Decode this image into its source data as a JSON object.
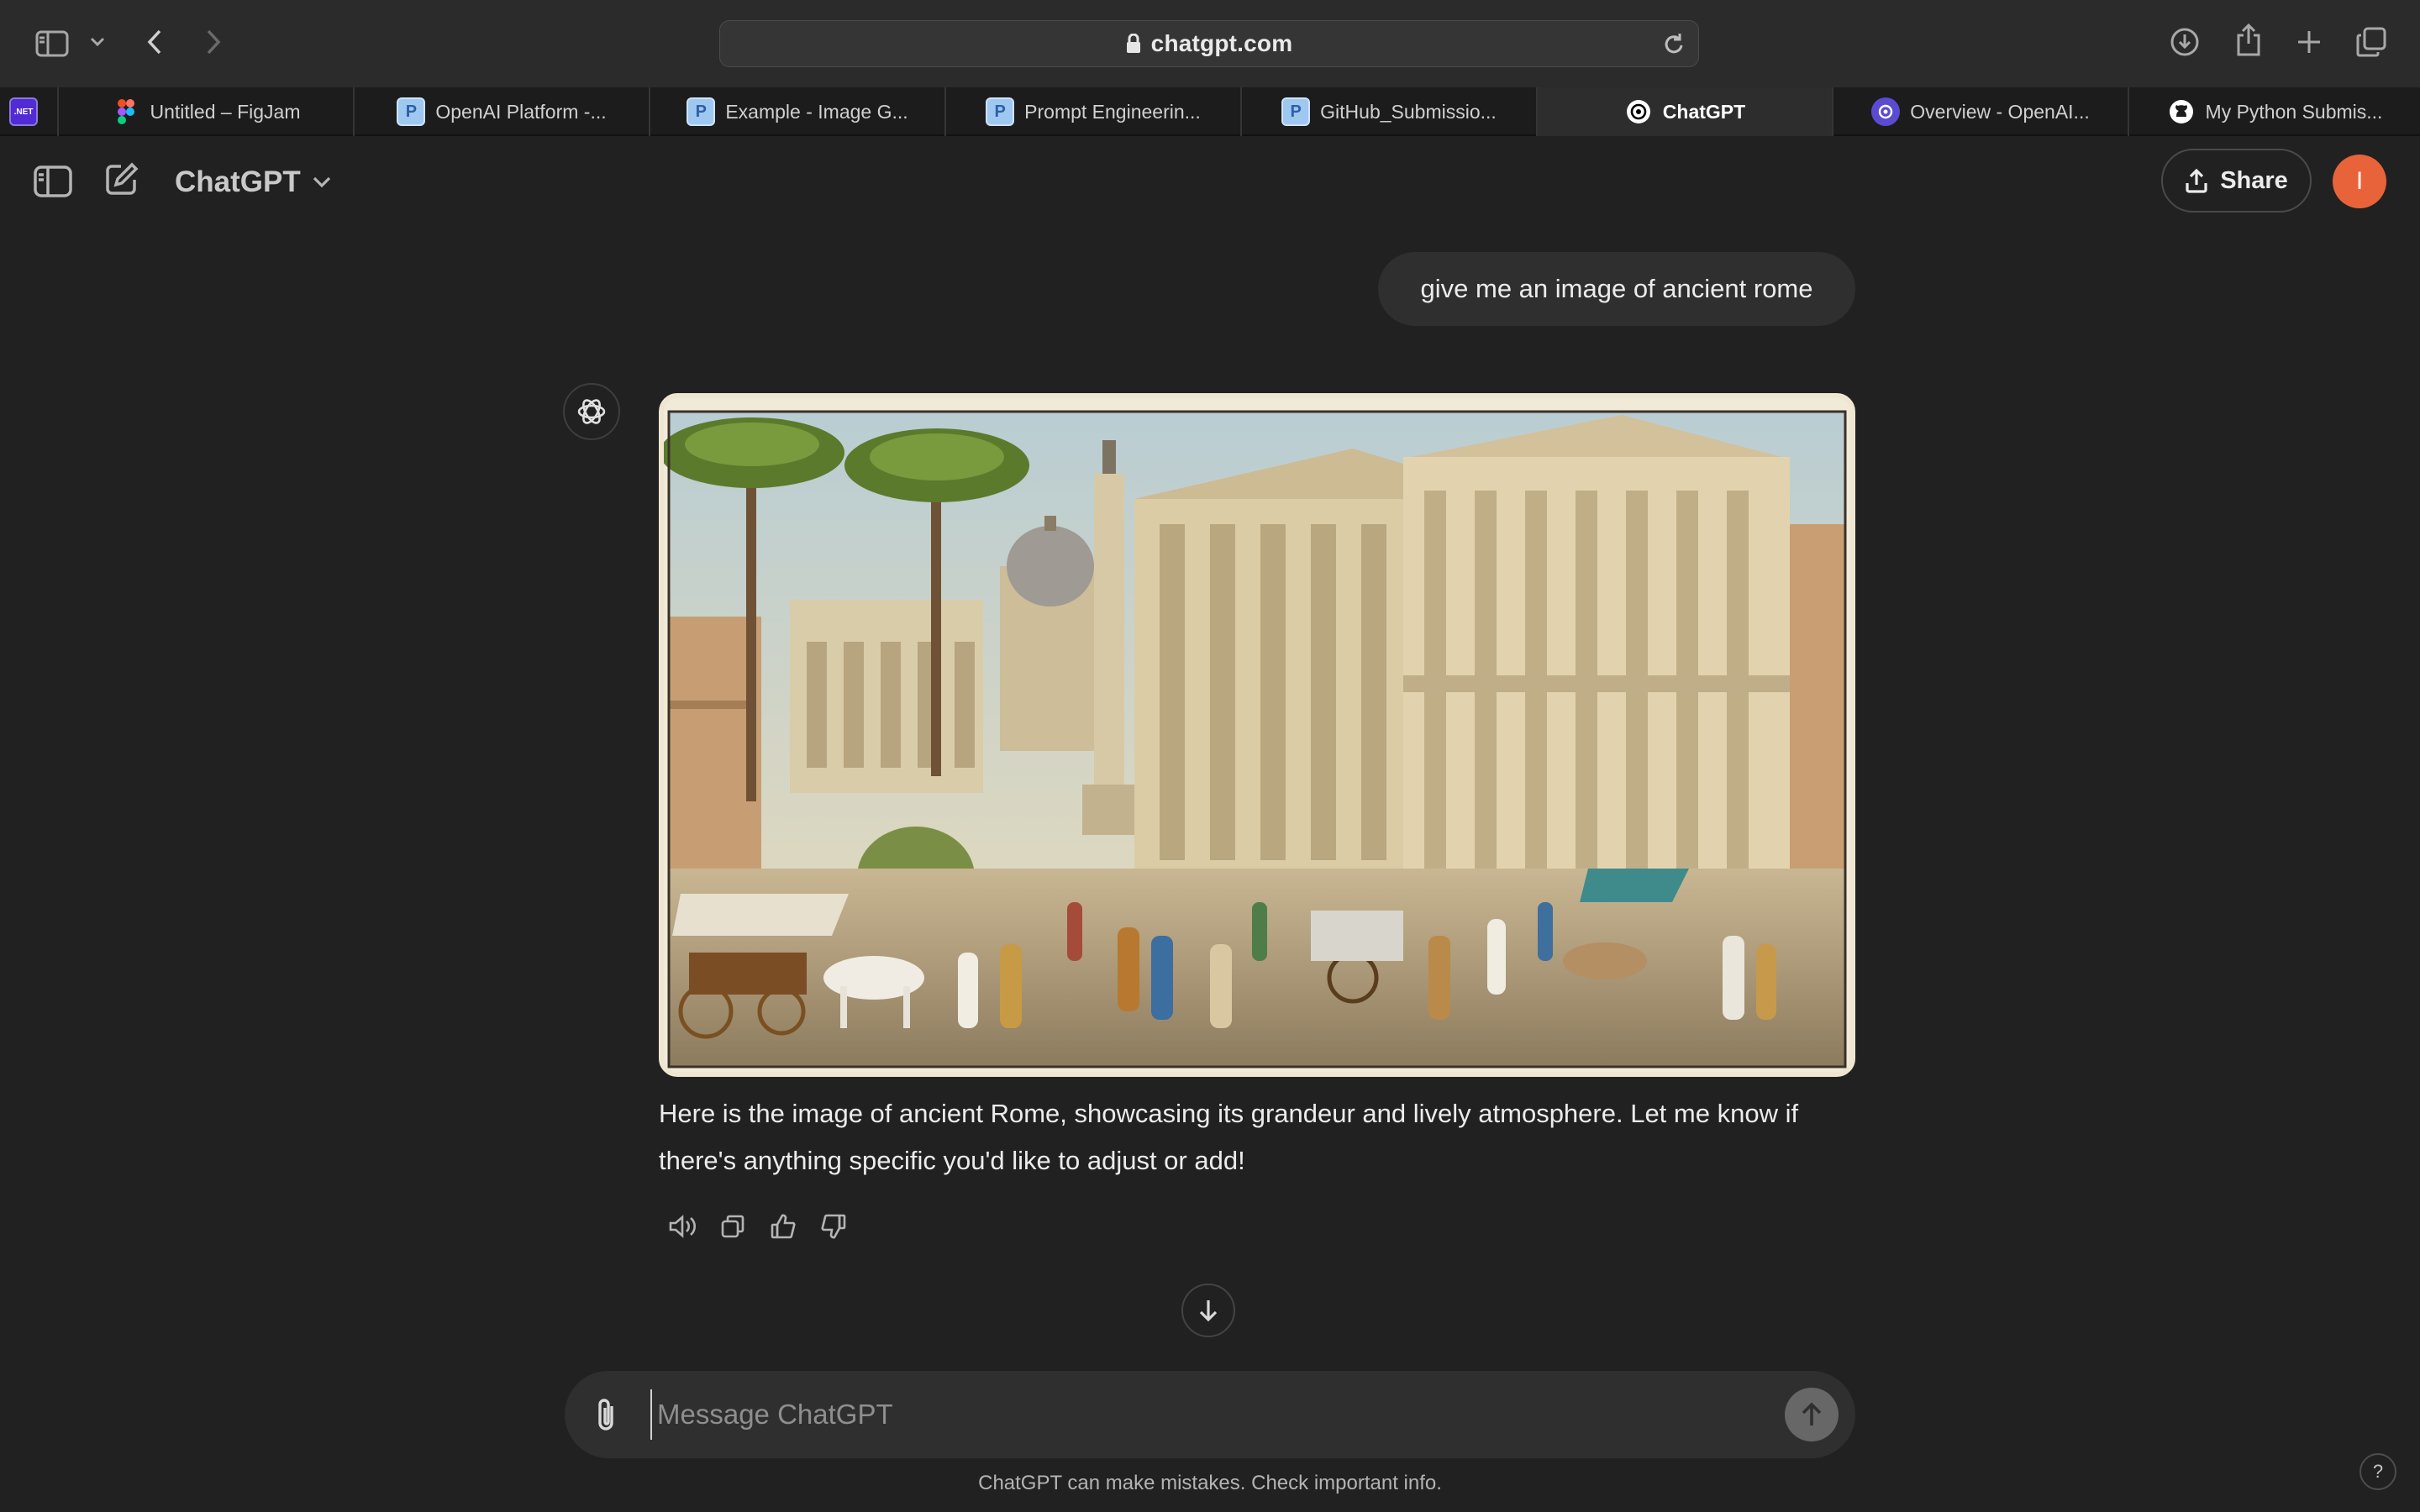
{
  "browser": {
    "url": "chatgpt.com",
    "tabs": [
      {
        "label": "",
        "favicon": ".NET"
      },
      {
        "label": "Untitled – FigJam",
        "favicon": "figma-icon"
      },
      {
        "label": "OpenAI Platform -...",
        "favicon": "P"
      },
      {
        "label": "Example - Image G...",
        "favicon": "P"
      },
      {
        "label": "Prompt Engineerin...",
        "favicon": "P"
      },
      {
        "label": "GitHub_Submissio...",
        "favicon": "P"
      },
      {
        "label": "ChatGPT",
        "favicon": "openai-icon",
        "active": true
      },
      {
        "label": "Overview - OpenAI...",
        "favicon": "openai-icon"
      },
      {
        "label": "My Python Submis...",
        "favicon": "github-icon"
      }
    ]
  },
  "header": {
    "model": "ChatGPT",
    "share_label": "Share",
    "avatar_initial": "I",
    "avatar_color": "#e8633a"
  },
  "conversation": {
    "user_message": "give me an image of ancient rome",
    "assistant_reply": "Here is the image of ancient Rome, showcasing its grandeur and lively atmosphere. Let me know if there's anything specific you'd like to adjust or add!",
    "actions": [
      "read-aloud-icon",
      "copy-icon",
      "thumbs-up-icon",
      "thumbs-down-icon"
    ]
  },
  "composer": {
    "placeholder": "Message ChatGPT"
  },
  "footer": {
    "disclaimer": "ChatGPT can make mistakes. Check important info.",
    "help": "?"
  },
  "theme": {
    "background": "#212121",
    "bubble": "#2f2f2f",
    "accent": "#e8633a"
  }
}
